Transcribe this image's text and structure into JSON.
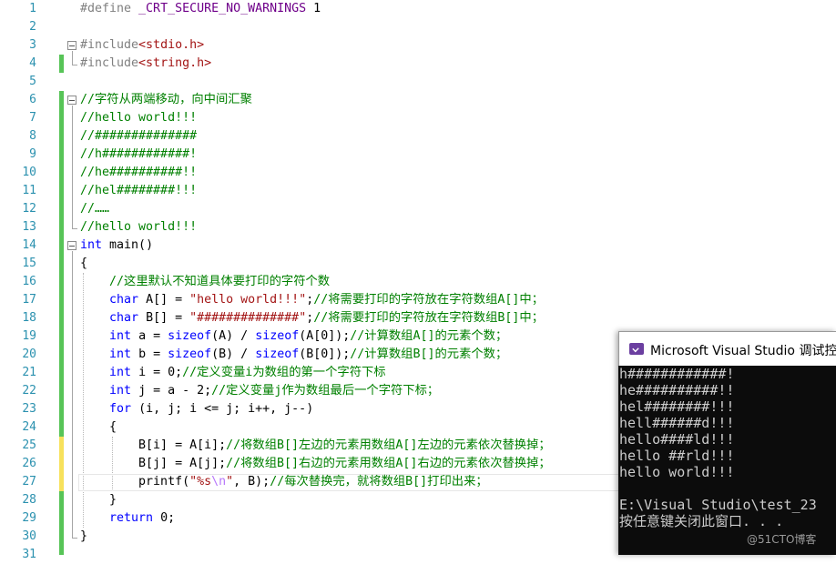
{
  "editor": {
    "lines": [
      {
        "num": "1",
        "tokens": [
          {
            "t": "#define ",
            "c": "pp"
          },
          {
            "t": "_CRT_SECURE_NO_WARNINGS",
            "c": "mac"
          },
          {
            "t": " 1",
            "c": ""
          }
        ]
      },
      {
        "num": "2",
        "tokens": []
      },
      {
        "num": "3",
        "tokens": [
          {
            "t": "#include",
            "c": "pp"
          },
          {
            "t": "<stdio.h>",
            "c": "str"
          }
        ]
      },
      {
        "num": "4",
        "tokens": [
          {
            "t": "#include",
            "c": "pp"
          },
          {
            "t": "<string.h>",
            "c": "str"
          }
        ]
      },
      {
        "num": "5",
        "tokens": []
      },
      {
        "num": "6",
        "tokens": [
          {
            "t": "//字符从两端移动，向中间汇聚",
            "c": "cm"
          }
        ]
      },
      {
        "num": "7",
        "tokens": [
          {
            "t": "//hello world!!!",
            "c": "cm"
          }
        ]
      },
      {
        "num": "8",
        "tokens": [
          {
            "t": "//##############",
            "c": "cm"
          }
        ]
      },
      {
        "num": "9",
        "tokens": [
          {
            "t": "//h############!",
            "c": "cm"
          }
        ]
      },
      {
        "num": "10",
        "tokens": [
          {
            "t": "//he##########!!",
            "c": "cm"
          }
        ]
      },
      {
        "num": "11",
        "tokens": [
          {
            "t": "//hel########!!!",
            "c": "cm"
          }
        ]
      },
      {
        "num": "12",
        "tokens": [
          {
            "t": "//……",
            "c": "cm"
          }
        ]
      },
      {
        "num": "13",
        "tokens": [
          {
            "t": "//hello world!!!",
            "c": "cm"
          }
        ]
      },
      {
        "num": "14",
        "tokens": [
          {
            "t": "int",
            "c": "kw"
          },
          {
            "t": " main()",
            "c": ""
          }
        ]
      },
      {
        "num": "15",
        "tokens": [
          {
            "t": "{",
            "c": ""
          }
        ]
      },
      {
        "num": "16",
        "tokens": [
          {
            "t": "    ",
            "c": ""
          },
          {
            "t": "//这里默认不知道具体要打印的字符个数",
            "c": "cm"
          }
        ]
      },
      {
        "num": "17",
        "tokens": [
          {
            "t": "    ",
            "c": ""
          },
          {
            "t": "char",
            "c": "kw"
          },
          {
            "t": " A[] = ",
            "c": ""
          },
          {
            "t": "\"hello world!!!\"",
            "c": "str"
          },
          {
            "t": ";",
            "c": ""
          },
          {
            "t": "//将需要打印的字符放在字符数组A[]中；",
            "c": "cm"
          }
        ]
      },
      {
        "num": "18",
        "tokens": [
          {
            "t": "    ",
            "c": ""
          },
          {
            "t": "char",
            "c": "kw"
          },
          {
            "t": " B[] = ",
            "c": ""
          },
          {
            "t": "\"##############\"",
            "c": "str"
          },
          {
            "t": ";",
            "c": ""
          },
          {
            "t": "//将需要打印的字符放在字符数组B[]中；",
            "c": "cm"
          }
        ]
      },
      {
        "num": "19",
        "tokens": [
          {
            "t": "    ",
            "c": ""
          },
          {
            "t": "int",
            "c": "kw"
          },
          {
            "t": " a = ",
            "c": ""
          },
          {
            "t": "sizeof",
            "c": "kw"
          },
          {
            "t": "(A) / ",
            "c": ""
          },
          {
            "t": "sizeof",
            "c": "kw"
          },
          {
            "t": "(A[0]);",
            "c": ""
          },
          {
            "t": "//计算数组A[]的元素个数；",
            "c": "cm"
          }
        ]
      },
      {
        "num": "20",
        "tokens": [
          {
            "t": "    ",
            "c": ""
          },
          {
            "t": "int",
            "c": "kw"
          },
          {
            "t": " b = ",
            "c": ""
          },
          {
            "t": "sizeof",
            "c": "kw"
          },
          {
            "t": "(B) / ",
            "c": ""
          },
          {
            "t": "sizeof",
            "c": "kw"
          },
          {
            "t": "(B[0]);",
            "c": ""
          },
          {
            "t": "//计算数组B[]的元素个数；",
            "c": "cm"
          }
        ]
      },
      {
        "num": "21",
        "tokens": [
          {
            "t": "    ",
            "c": ""
          },
          {
            "t": "int",
            "c": "kw"
          },
          {
            "t": " i = 0;",
            "c": ""
          },
          {
            "t": "//定义变量i为数组的第一个字符下标",
            "c": "cm"
          }
        ]
      },
      {
        "num": "22",
        "tokens": [
          {
            "t": "    ",
            "c": ""
          },
          {
            "t": "int",
            "c": "kw"
          },
          {
            "t": " j = a - 2;",
            "c": ""
          },
          {
            "t": "//定义变量j作为数组最后一个字符下标；",
            "c": "cm"
          }
        ]
      },
      {
        "num": "23",
        "tokens": [
          {
            "t": "    ",
            "c": ""
          },
          {
            "t": "for",
            "c": "kw"
          },
          {
            "t": " (i, j; i <= j; i++, j--)",
            "c": ""
          }
        ]
      },
      {
        "num": "24",
        "tokens": [
          {
            "t": "    {",
            "c": ""
          }
        ]
      },
      {
        "num": "25",
        "tokens": [
          {
            "t": "        B[i] = A[i];",
            "c": ""
          },
          {
            "t": "//将数组B[]左边的元素用数组A[]左边的元素依次替换掉；",
            "c": "cm"
          }
        ]
      },
      {
        "num": "26",
        "tokens": [
          {
            "t": "        B[j] = A[j];",
            "c": ""
          },
          {
            "t": "//将数组B[]右边的元素用数组A[]右边的元素依次替换掉；",
            "c": "cm"
          }
        ]
      },
      {
        "num": "27",
        "tokens": [
          {
            "t": "        printf(",
            "c": ""
          },
          {
            "t": "\"%s",
            "c": "str"
          },
          {
            "t": "\\n",
            "c": "esc"
          },
          {
            "t": "\"",
            "c": "str"
          },
          {
            "t": ", B);",
            "c": ""
          },
          {
            "t": "//每次替换完，就将数组B[]打印出来；",
            "c": "cm"
          }
        ]
      },
      {
        "num": "28",
        "tokens": [
          {
            "t": "    }",
            "c": ""
          }
        ]
      },
      {
        "num": "29",
        "tokens": [
          {
            "t": "    ",
            "c": ""
          },
          {
            "t": "return",
            "c": "kw"
          },
          {
            "t": " 0;",
            "c": ""
          }
        ]
      },
      {
        "num": "30",
        "tokens": [
          {
            "t": "}",
            "c": ""
          }
        ]
      },
      {
        "num": "31",
        "tokens": []
      }
    ]
  },
  "console": {
    "title": "Microsoft Visual Studio 调试控",
    "lines": [
      "h############!",
      "he##########!!",
      "hel########!!!",
      "hell######d!!!",
      "hello####ld!!!",
      "hello ##rld!!!",
      "hello world!!!",
      "",
      "E:\\Visual Studio\\test_23",
      "按任意键关闭此窗口. . ."
    ]
  },
  "watermark": "@51CTO博客"
}
